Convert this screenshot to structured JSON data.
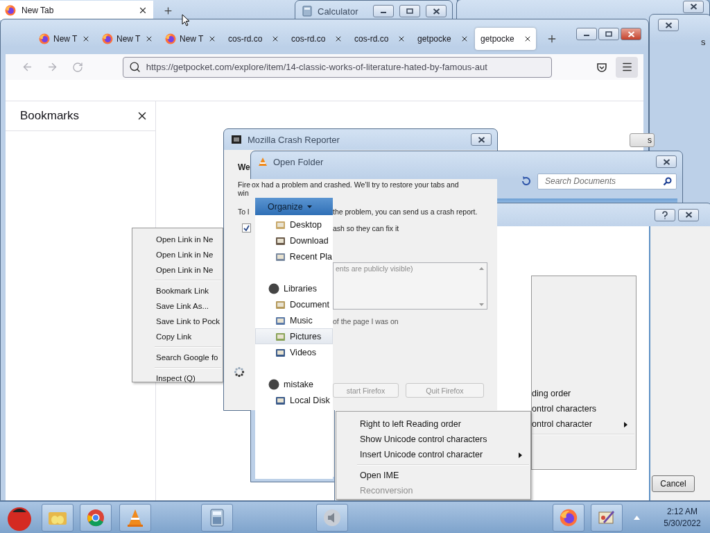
{
  "background_browser": {
    "tab": {
      "label": "New Tab"
    }
  },
  "calculator": {
    "title": "Calculator"
  },
  "right_window": {
    "edge_fragment": "s",
    "button_fragment": "s"
  },
  "browser": {
    "tabs": [
      {
        "label": "New T",
        "favicon": true,
        "selected": false
      },
      {
        "label": "New T",
        "favicon": true,
        "selected": false
      },
      {
        "label": "New T",
        "favicon": true,
        "selected": false
      },
      {
        "label": "cos-rd.co",
        "favicon": false,
        "selected": false
      },
      {
        "label": "cos-rd.co",
        "favicon": false,
        "selected": false
      },
      {
        "label": "cos-rd.co",
        "favicon": false,
        "selected": false
      },
      {
        "label": "getpocke",
        "favicon": false,
        "selected": false
      },
      {
        "label": "getpocke",
        "favicon": false,
        "selected": true
      }
    ],
    "address": "https://getpocket.com/explore/item/14-classic-works-of-literature-hated-by-famous-aut",
    "sidebar": {
      "title": "Bookmarks"
    }
  },
  "link_menu": {
    "items": [
      {
        "kind": "item",
        "label": "Open Link in Ne"
      },
      {
        "kind": "item",
        "label": "Open Link in Ne"
      },
      {
        "kind": "item",
        "label": "Open Link in Ne"
      },
      {
        "kind": "separator"
      },
      {
        "kind": "item",
        "label": "Bookmark Link"
      },
      {
        "kind": "item",
        "label": "Save Link As..."
      },
      {
        "kind": "item",
        "label": "Save Link to Pock"
      },
      {
        "kind": "item",
        "label": "Copy Link"
      },
      {
        "kind": "separator"
      },
      {
        "kind": "item",
        "label": "Search Google fo"
      },
      {
        "kind": "separator"
      },
      {
        "kind": "item",
        "label": "Inspect (Q)"
      }
    ]
  },
  "crash_reporter": {
    "title": "Mozilla Crash Reporter",
    "heading": "We",
    "intro_start": "Fire",
    "intro_rest": "ox had a problem and crashed. We’ll try to restore your tabs and",
    "intro_line2": "win",
    "prompt_start": "To l",
    "prompt_rest": "the problem, you can send us a crash report.",
    "send_report": {
      "checked": true
    },
    "send_label": "ash so they can fix it",
    "comment_placeholder": "ents are publicly visible)",
    "include_url_label": "of the page I was on",
    "buttons": [
      "start Firefox",
      "Quit Firefox"
    ]
  },
  "open_folder": {
    "title": "Open Folder",
    "search": {
      "placeholder": "Search Documents"
    },
    "organize": "Organize",
    "nav": [
      {
        "children": [
          {
            "label": "Desktop",
            "selected": false
          },
          {
            "label": "Download",
            "selected": false
          },
          {
            "label": "Recent Pla",
            "selected": false
          }
        ]
      },
      {
        "label": "Libraries",
        "children": [
          {
            "label": "Document",
            "selected": false
          },
          {
            "label": "Music",
            "selected": false
          },
          {
            "label": "Pictures",
            "selected": true
          },
          {
            "label": "Videos",
            "selected": false
          }
        ]
      },
      {
        "label": "mistake",
        "children": [
          {
            "label": "Local Disk",
            "selected": false
          }
        ]
      }
    ]
  },
  "back_dialog": {
    "menu_fragments": [
      {
        "label": "ding order",
        "submenu": false
      },
      {
        "label": "ontrol characters",
        "submenu": false
      },
      {
        "label": "ontrol character",
        "submenu": true
      }
    ],
    "cancel": "Cancel"
  },
  "context_menu": {
    "items": [
      {
        "kind": "item",
        "label": "Right to left Reading order",
        "submenu": false,
        "disabled": false
      },
      {
        "kind": "item",
        "label": "Show Unicode control characters",
        "submenu": false,
        "disabled": false
      },
      {
        "kind": "item",
        "label": "Insert Unicode control character",
        "submenu": true,
        "disabled": false
      },
      {
        "kind": "separator"
      },
      {
        "kind": "item",
        "label": "Open IME",
        "submenu": false,
        "disabled": false
      },
      {
        "kind": "item",
        "label": "Reconversion",
        "submenu": false,
        "disabled": true
      }
    ]
  },
  "taskbar": {
    "time": "2:12 AM",
    "date": "5/30/2022"
  }
}
